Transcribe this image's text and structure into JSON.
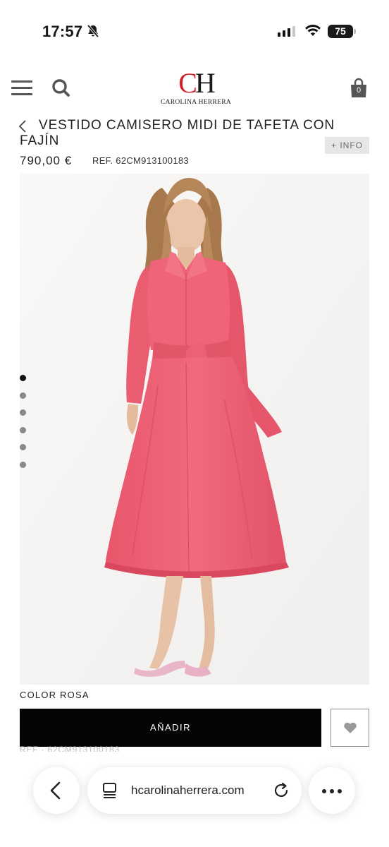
{
  "status_bar": {
    "time": "17:57",
    "battery": "75",
    "icons": [
      "bell-slash-icon",
      "cellular-signal-icon",
      "wifi-icon",
      "battery-icon"
    ]
  },
  "header": {
    "logo_monogram_c": "C",
    "logo_monogram_h": "H",
    "logo_name": "CAROLINA HERRERA",
    "cart_count": "0",
    "icons": [
      "hamburger-menu-icon",
      "search-icon",
      "shopping-bag-icon"
    ]
  },
  "product": {
    "title": "VESTIDO CAMISERO MIDI DE TAFETA CON FAJÍN",
    "info_button": "+ INFO",
    "price": "790,00 €",
    "ref": "REF. 62CM913100183",
    "image_count": 6,
    "active_image": 1,
    "color_label": "COLOR ROSA",
    "add_button": "AÑADIR",
    "ghost_ref": "REF · 62CM913100183"
  },
  "browser": {
    "url": "hcarolinaherrera.com",
    "icons": [
      "back-arrow-icon",
      "tabs-icon",
      "reload-icon",
      "more-icon"
    ]
  },
  "colors": {
    "brand_red": "#d4202c",
    "dress_pink": "#ee6478",
    "button_black": "#050505"
  }
}
